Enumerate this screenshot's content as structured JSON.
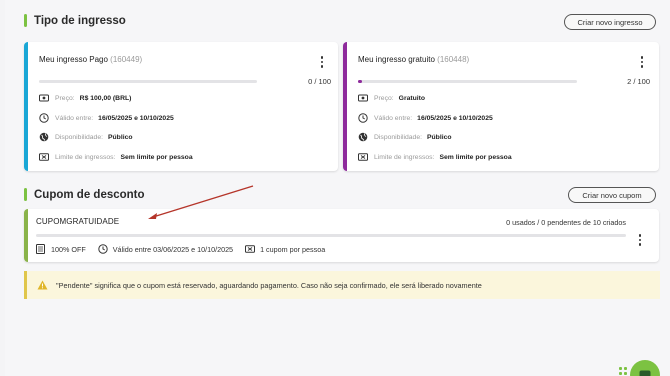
{
  "ticket_section": {
    "title": "Tipo de ingresso",
    "create_button": "Criar novo ingresso",
    "tickets": [
      {
        "name": "Meu ingresso Pago",
        "id": "(160449)",
        "count": "0 / 100",
        "progress_fraction": 0,
        "accent": "#1aa7d6",
        "price_label": "Preço:",
        "price_value": "R$ 100,00 (BRL)",
        "valid_label": "Válido entre:",
        "valid_value": "16/05/2025 e 10/10/2025",
        "avail_label": "Disponibilidade:",
        "avail_value": "Público",
        "limit_label": "Limite de ingressos:",
        "limit_value": "Sem limite por pessoa"
      },
      {
        "name": "Meu ingresso gratuito",
        "id": "(160448)",
        "count": "2 / 100",
        "progress_fraction": 0.02,
        "accent": "#8e2a9c",
        "price_label": "Preço:",
        "price_value": "Gratuito",
        "valid_label": "Válido entre:",
        "valid_value": "16/05/2025 e 10/10/2025",
        "avail_label": "Disponibilidade:",
        "avail_value": "Público",
        "limit_label": "Limite de ingressos:",
        "limit_value": "Sem limite por pessoa"
      }
    ]
  },
  "coupon_section": {
    "title": "Cupom de desconto",
    "create_button": "Criar novo cupom",
    "coupon": {
      "code": "CUPOMGRATUIDADE",
      "stats": "0 usados / 0 pendentes de 10 criados",
      "discount": "100% OFF",
      "validity": "Válido entre 03/06/2025 e 10/10/2025",
      "limit": "1 cupom por pessoa",
      "accent": "#8ab34a"
    }
  },
  "alert": {
    "text": "\"Pendente\" significa que o cupom está reservado, aguardando pagamento. Caso não seja confirmado, ele será liberado novamente"
  },
  "colors": {
    "brand_green": "#7cc242",
    "annotation_arrow": "#b5352a"
  }
}
